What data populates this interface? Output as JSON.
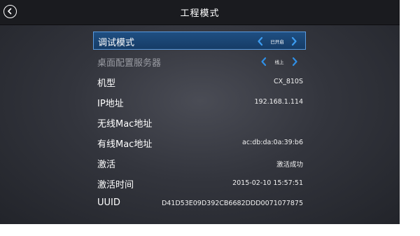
{
  "header": {
    "title": "工程模式"
  },
  "settings": {
    "debug_mode": {
      "label": "调试模式",
      "value": "已开启"
    },
    "desktop_config_server": {
      "label": "桌面配置服务器",
      "value": "线上"
    },
    "model": {
      "label": "机型",
      "value": "CX_810S"
    },
    "ip_address": {
      "label": "IP地址",
      "value": "192.168.1.114"
    },
    "wireless_mac": {
      "label": "无线Mac地址",
      "value": ""
    },
    "wired_mac": {
      "label": "有线Mac地址",
      "value": "ac:db:da:0a:39:b6"
    },
    "activation": {
      "label": "激活",
      "value": "激活成功"
    },
    "activation_time": {
      "label": "激活时间",
      "value": "2015-02-10 15:57:51"
    },
    "uuid": {
      "label": "UUID",
      "value": "D41D53E09D392CB6682DDD0071077875"
    }
  },
  "colors": {
    "accent": "#2f8fe6",
    "selected_row": "#1f4f82",
    "selected_border": "#5a9be0",
    "disabled_text": "#9a9ca3"
  }
}
